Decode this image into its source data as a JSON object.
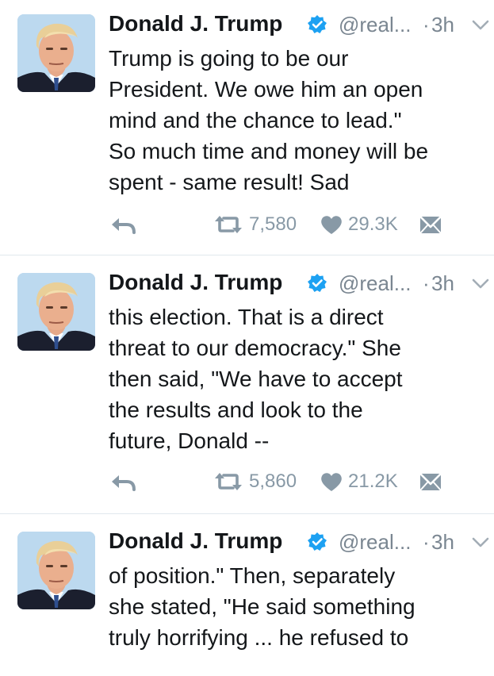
{
  "colors": {
    "verified_badge": "#1da1f2",
    "secondary_text": "#7a8691",
    "action_gray": "#8899a6",
    "divider": "#e1e8ed"
  },
  "icons": {
    "verified": "verified-badge-icon",
    "caret": "chevron-down-icon",
    "reply": "reply-arrow-icon",
    "retweet": "retweet-icon",
    "like": "heart-icon",
    "message": "envelope-icon"
  },
  "tweets": [
    {
      "name": "Donald J. Trump",
      "handle": "@real...",
      "dot": "·",
      "time": "3h",
      "text": "Trump is going to be our\nPresident. We owe him an open\nmind and the chance to lead.\"\nSo much time and money will be\nspent - same result! Sad",
      "retweets": "7,580",
      "likes": "29.3K"
    },
    {
      "name": "Donald J. Trump",
      "handle": "@real...",
      "dot": "·",
      "time": "3h",
      "text": "this election. That is a direct\nthreat to our democracy.\" She\nthen said, \"We have to accept\nthe results and look to the\nfuture, Donald --",
      "retweets": "5,860",
      "likes": "21.2K"
    },
    {
      "name": "Donald J. Trump",
      "handle": "@real...",
      "dot": "·",
      "time": "3h",
      "text": "of position.\" Then, separately\nshe stated, \"He said something\ntruly horrifying ... he refused to"
    }
  ]
}
